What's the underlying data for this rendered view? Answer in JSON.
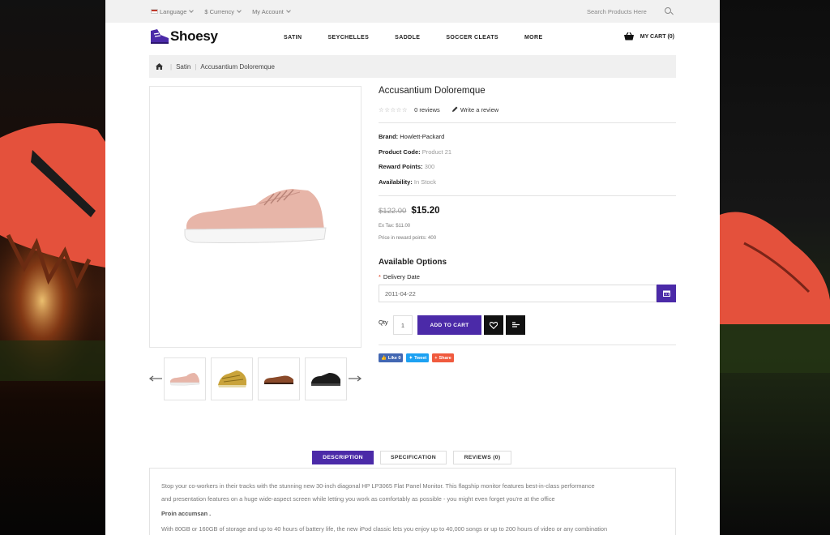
{
  "topbar": {
    "language": "Language",
    "currency": "$ Currency",
    "account": "My Account",
    "search_placeholder": "Search Products Here"
  },
  "header": {
    "logo_text": "Shoesy",
    "nav": [
      "SATIN",
      "SEYCHELLES",
      "SADDLE",
      "SOCCER CLEATS",
      "MORE"
    ],
    "cart_label": "MY CART (0)"
  },
  "breadcrumb": {
    "items": [
      "Satin",
      "Accusantium Doloremque"
    ]
  },
  "product": {
    "title": "Accusantium Doloremque",
    "rating_stars": "☆☆☆☆☆",
    "reviews_link": "0 reviews",
    "write_review": "Write a review",
    "specs": [
      {
        "label": "Brand:",
        "value": "Howlett-Packard"
      },
      {
        "label": "Product Code:",
        "value": "Product 21"
      },
      {
        "label": "Reward Points:",
        "value": "300"
      },
      {
        "label": "Availability:",
        "value": "In Stock"
      }
    ],
    "old_price": "$122.00",
    "new_price": "$15.20",
    "ex_tax": "Ex Tax: $11.00",
    "reward_note": "Price in reward points: 400",
    "options_title": "Available Options",
    "required_mark": "*",
    "delivery_label": "Delivery Date",
    "delivery_value": "2011-04-22",
    "qty_label": "Qty",
    "qty_value": "1",
    "add_to_cart": "ADD TO CART",
    "share": {
      "like": "Like 0",
      "tweet": "Tweet",
      "share": "Share"
    }
  },
  "tabs": [
    "DESCRIPTION",
    "SPECIFICATION",
    "REVIEWS (0)"
  ],
  "description": {
    "para1": "Stop your co-workers in their tracks with the stunning new 30-inch diagonal HP LP3065 Flat Panel Monitor. This flagship monitor features best-in-class performance",
    "para1b": "and presentation features on a huge wide-aspect screen while letting you work as comfortably as possible - you might even forget you're at the office",
    "heading": "Proin accumsan .",
    "para2": "With 80GB or 160GB of storage and up to 40 hours of battery life, the new iPod classic lets you enjoy up to 40,000 songs or up to 200 hours of video or any combination"
  },
  "colors": {
    "accent": "#4b2aa8",
    "shoe_main": "#e6b3a6",
    "shoe_gold": "#c9a33a",
    "shoe_brown": "#8a4a2a",
    "shoe_black": "#1c1c1c"
  }
}
